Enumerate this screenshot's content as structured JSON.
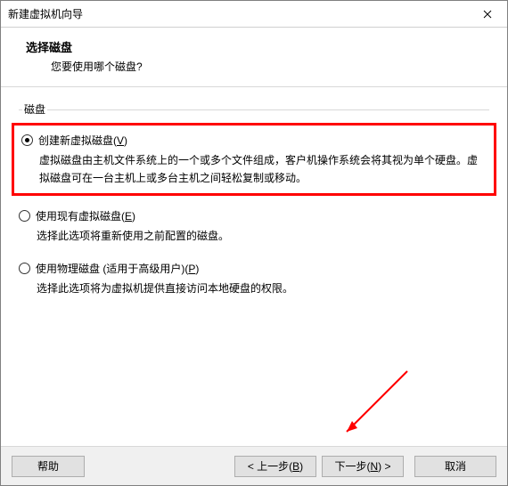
{
  "window": {
    "title": "新建虚拟机向导"
  },
  "header": {
    "title": "选择磁盘",
    "subtitle": "您要使用哪个磁盘?"
  },
  "group": {
    "label": "磁盘"
  },
  "options": {
    "create": {
      "label_pre": "创建新虚拟磁盘(",
      "access": "V",
      "label_post": ")",
      "desc": "虚拟磁盘由主机文件系统上的一个或多个文件组成，客户机操作系统会将其视为单个硬盘。虚拟磁盘可在一台主机上或多台主机之间轻松复制或移动。"
    },
    "existing": {
      "label_pre": "使用现有虚拟磁盘(",
      "access": "E",
      "label_post": ")",
      "desc": "选择此选项将重新使用之前配置的磁盘。"
    },
    "physical": {
      "label_pre": "使用物理磁盘 (适用于高级用户)(",
      "access": "P",
      "label_post": ")",
      "desc": "选择此选项将为虚拟机提供直接访问本地硬盘的权限。"
    }
  },
  "buttons": {
    "help": "帮助",
    "back_pre": "< 上一步(",
    "back_access": "B",
    "back_post": ")",
    "next_pre": "下一步(",
    "next_access": "N",
    "next_post": ") >",
    "cancel": "取消"
  }
}
